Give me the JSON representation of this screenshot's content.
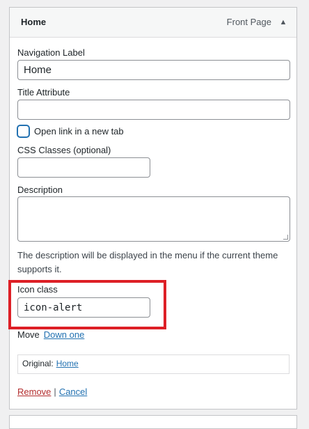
{
  "menu_item": {
    "title": "Home",
    "type_label": "Front Page",
    "toggle_icon": "arrow-up-icon"
  },
  "fields": {
    "navigation_label": {
      "label": "Navigation Label",
      "value": "Home"
    },
    "title_attribute": {
      "label": "Title Attribute",
      "value": ""
    },
    "open_new_tab": {
      "label": "Open link in a new tab",
      "checked": false
    },
    "css_classes": {
      "label": "CSS Classes (optional)",
      "value": ""
    },
    "description": {
      "label": "Description",
      "value": "",
      "help": "The description will be displayed in the menu if the current theme supports it."
    },
    "icon_class": {
      "label": "Icon class",
      "value": "icon-alert"
    }
  },
  "move": {
    "label": "Move",
    "down_one": "Down one"
  },
  "original": {
    "label": "Original:",
    "link_text": "Home"
  },
  "actions": {
    "remove": "Remove",
    "separator": "|",
    "cancel": "Cancel"
  },
  "colors": {
    "highlight": "#dd1f26",
    "link": "#2271b1",
    "remove": "#b32d2e"
  }
}
